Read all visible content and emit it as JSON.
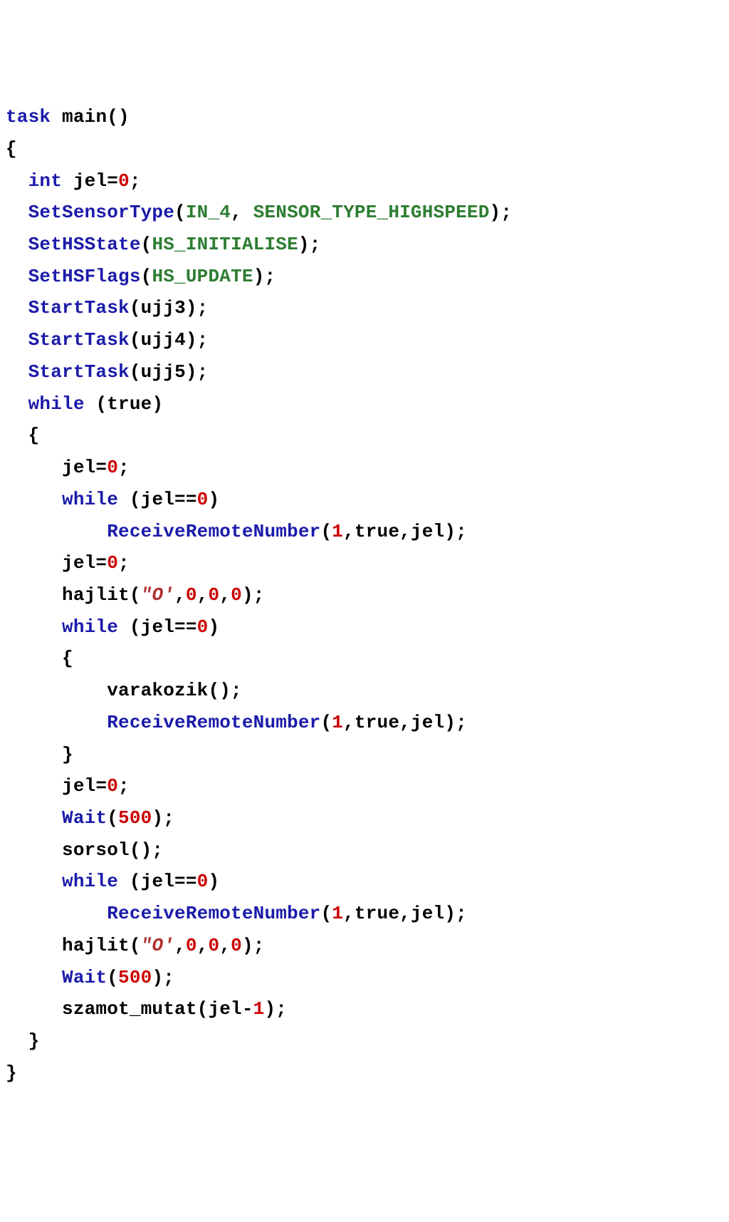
{
  "code": {
    "l1_kw": "task",
    "l1_name": "main",
    "l1_par": "()",
    "l2": "{",
    "l3_indent": "  ",
    "l3_kw": "int",
    "l3_sp": " ",
    "l3_id": "jel=",
    "l3_num": "0",
    "l3_end": ";",
    "l4_indent": "  ",
    "l4_fn": "SetSensorType",
    "l4_open": "(",
    "l4_a1": "IN_4",
    "l4_comma": ", ",
    "l4_a2": "SENSOR_TYPE_HIGHSPEED",
    "l4_close": ");",
    "l5_indent": "  ",
    "l5_fn": "SetHSState",
    "l5_open": "(",
    "l5_a1": "HS_INITIALISE",
    "l5_close": ");",
    "l6_indent": "  ",
    "l6_fn": "SetHSFlags",
    "l6_open": "(",
    "l6_a1": "HS_UPDATE",
    "l6_close": ");",
    "l7_indent": "  ",
    "l7_fn": "StartTask",
    "l7_open": "(",
    "l7_a1": "ujj3",
    "l7_close": ");",
    "l8_indent": "  ",
    "l8_fn": "StartTask",
    "l8_open": "(",
    "l8_a1": "ujj4",
    "l8_close": ");",
    "l9_indent": "  ",
    "l9_fn": "StartTask",
    "l9_open": "(",
    "l9_a1": "ujj5",
    "l9_close": ");",
    "l10_indent": "  ",
    "l10_kw": "while",
    "l10_sp": " ",
    "l10_cond": "(true)",
    "l11": "  {",
    "l12_indent": "     ",
    "l12_id": "jel=",
    "l12_num": "0",
    "l12_end": ";",
    "l13_indent": "     ",
    "l13_kw": "while",
    "l13_sp": " ",
    "l13_cond": "(jel==",
    "l13_num": "0",
    "l13_close": ")",
    "l14_indent": "         ",
    "l14_fn": "ReceiveRemoteNumber",
    "l14_open": "(",
    "l14_n": "1",
    "l14_rest": ",true,jel);",
    "l15_indent": "     ",
    "l15_id": "jel=",
    "l15_num": "0",
    "l15_end": ";",
    "l16_indent": "     ",
    "l16_id": "hajlit(",
    "l16_str": "\"O'",
    "l16_rest": ",",
    "l16_n1": "0",
    "l16_c1": ",",
    "l16_n2": "0",
    "l16_c2": ",",
    "l16_n3": "0",
    "l16_close": ");",
    "l17_indent": "     ",
    "l17_kw": "while",
    "l17_sp": " ",
    "l17_cond": "(jel==",
    "l17_num": "0",
    "l17_close": ")",
    "l18": "     {",
    "l19_indent": "         ",
    "l19_id": "varakozik();",
    "l20_indent": "         ",
    "l20_fn": "ReceiveRemoteNumber",
    "l20_open": "(",
    "l20_n": "1",
    "l20_rest": ",true,jel);",
    "l21": "     }",
    "l22_indent": "     ",
    "l22_id": "jel=",
    "l22_num": "0",
    "l22_end": ";",
    "l23_indent": "     ",
    "l23_fn": "Wait",
    "l23_open": "(",
    "l23_n": "500",
    "l23_close": ");",
    "l24_indent": "     ",
    "l24_id": "sorsol();",
    "l25_indent": "     ",
    "l25_kw": "while",
    "l25_sp": " ",
    "l25_cond": "(jel==",
    "l25_num": "0",
    "l25_close": ")",
    "l26_indent": "         ",
    "l26_fn": "ReceiveRemoteNumber",
    "l26_open": "(",
    "l26_n": "1",
    "l26_rest": ",true,jel);",
    "l27_indent": "     ",
    "l27_id": "hajlit(",
    "l27_str": "\"O'",
    "l27_rest": ",",
    "l27_n1": "0",
    "l27_c1": ",",
    "l27_n2": "0",
    "l27_c2": ",",
    "l27_n3": "0",
    "l27_close": ");",
    "l28_indent": "     ",
    "l28_fn": "Wait",
    "l28_open": "(",
    "l28_n": "500",
    "l28_close": ");",
    "l29_indent": "     ",
    "l29_id": "szamot_mutat(jel-",
    "l29_n": "1",
    "l29_close": ");",
    "l30": "  }",
    "l31": "}"
  }
}
